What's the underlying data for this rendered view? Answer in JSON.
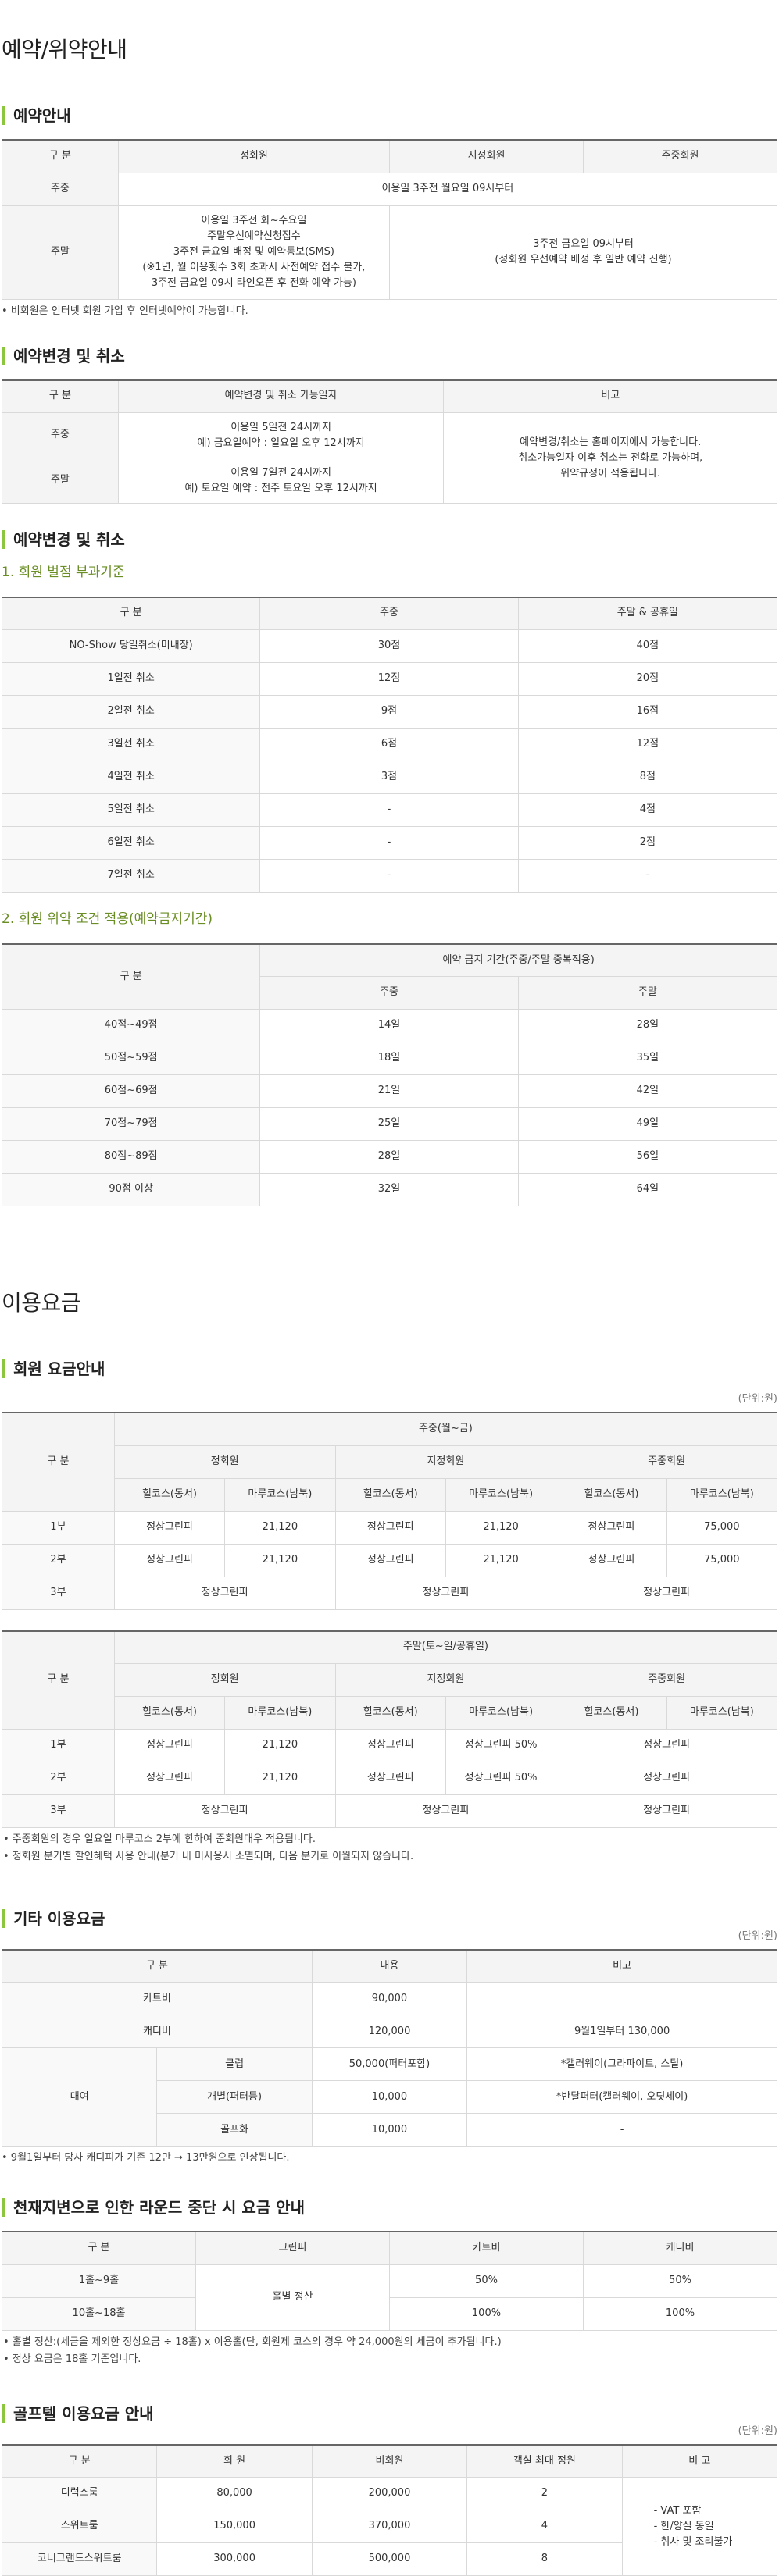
{
  "reservation": {
    "page_title": "예약/위약안내",
    "info": {
      "title": "예약안내",
      "headers": [
        "구 분",
        "정회원",
        "지정회원",
        "주중회원"
      ],
      "weekday": {
        "label": "주중",
        "text": "이용일 3주전 월요일 09시부터"
      },
      "weekend": {
        "label": "주말",
        "regular": [
          "이용일 3주전 화~수요일",
          "주말우선예약신청접수",
          "3주전 금요일 배정 및 예약통보(SMS)",
          "(※1년, 월 이용횟수 3회 초과시 사전예약 접수 불가,",
          "3주전 금요일 09시 타인오픈 후 전화 예약 가능)"
        ],
        "designated": [
          "3주전 금요일 09시부터",
          "(정회원 우선예약 배정 후 일반 예약 진행)"
        ]
      },
      "note": "• 비회원은 인터넷 회원 가입 후 인터넷예약이 가능합니다."
    },
    "change": {
      "title": "예약변경 및 취소",
      "headers": [
        "구 분",
        "예약변경 및 취소 가능일자",
        "비고"
      ],
      "weekday": {
        "label": "주중",
        "lines": [
          "이용일 5일전 24시까지",
          "예) 금요일예약 : 일요일 오후 12시까지"
        ]
      },
      "weekend": {
        "label": "주말",
        "lines": [
          "이용일 7일전 24시까지",
          "예) 토요일 예약 : 전주 토요일 오후 12시까지"
        ]
      },
      "remark": [
        "예약변경/취소는 홈페이지에서 가능합니다.",
        "취소가능일자 이후 취소는 전화로 가능하며,",
        "위약규정이 적용됩니다."
      ]
    },
    "penalty": {
      "title": "예약변경 및 취소",
      "sub1": "1. 회원 벌점 부과기준",
      "headers1": [
        "구 분",
        "주중",
        "주말 & 공휴일"
      ],
      "rows1": [
        [
          "NO-Show 당일취소(미내장)",
          "30점",
          "40점"
        ],
        [
          "1일전 취소",
          "12점",
          "20점"
        ],
        [
          "2일전 취소",
          "9점",
          "16점"
        ],
        [
          "3일전 취소",
          "6점",
          "12점"
        ],
        [
          "4일전 취소",
          "3점",
          "8점"
        ],
        [
          "5일전 취소",
          "-",
          "4점"
        ],
        [
          "6일전 취소",
          "-",
          "2점"
        ],
        [
          "7일전 취소",
          "-",
          "-"
        ]
      ],
      "sub2": "2. 회원 위약 조건 적용(예약금지기간)",
      "headers2": {
        "label": "구 분",
        "group": "예약 금지 기간(주중/주말 중복적용)",
        "weekday": "주중",
        "weekend": "주말"
      },
      "rows2": [
        [
          "40점~49점",
          "14일",
          "28일"
        ],
        [
          "50점~59점",
          "18일",
          "35일"
        ],
        [
          "60점~69점",
          "21일",
          "42일"
        ],
        [
          "70점~79점",
          "25일",
          "49일"
        ],
        [
          "80점~89점",
          "28일",
          "56일"
        ],
        [
          "90점 이상",
          "32일",
          "64일"
        ]
      ]
    }
  },
  "fees": {
    "page_title": "이용요금",
    "member": {
      "title": "회원 요금안내",
      "unit": "(단위:원)",
      "label": "구 분",
      "weekday_group": "주중(월~금)",
      "weekend_group": "주말(토~일/공휴일)",
      "members": [
        "정회원",
        "지정회원",
        "주중회원"
      ],
      "courses": [
        "힐코스(동서)",
        "마루코스(남북)"
      ],
      "weekday_rows": [
        {
          "label": "1부",
          "cells": [
            "정상그린피",
            "21,120",
            "정상그린피",
            "21,120",
            "정상그린피",
            "75,000"
          ]
        },
        {
          "label": "2부",
          "cells": [
            "정상그린피",
            "21,120",
            "정상그린피",
            "21,120",
            "정상그린피",
            "75,000"
          ]
        },
        {
          "label": "3부",
          "cells": [
            "정상그린피",
            "정상그린피",
            "정상그린피"
          ]
        }
      ],
      "weekend_rows": [
        {
          "label": "1부",
          "cells": [
            "정상그린피",
            "21,120",
            "정상그린피",
            "정상그린피 50%",
            "정상그린피"
          ]
        },
        {
          "label": "2부",
          "cells": [
            "정상그린피",
            "21,120",
            "정상그린피",
            "정상그린피 50%",
            "정상그린피"
          ]
        },
        {
          "label": "3부",
          "cells": [
            "정상그린피",
            "정상그린피",
            "정상그린피"
          ]
        }
      ],
      "notes": [
        "• 주중회원의 경우 일요일 마루코스 2부에 한하여 준회원대우 적용됩니다.",
        "• 정회원 분기별 할인혜택 사용 안내(분기 내 미사용시 소멸되며, 다음 분기로 이월되지 않습니다."
      ]
    },
    "other": {
      "title": "기타 이용요금",
      "unit": "(단위:원)",
      "headers": [
        "구 분",
        "내용",
        "비고"
      ],
      "cart": {
        "label": "카트비",
        "value": "90,000",
        "remark": ""
      },
      "caddie": {
        "label": "캐디비",
        "value": "120,000",
        "remark": "9월1일부터 130,000"
      },
      "rental_label": "대여",
      "rentals": [
        {
          "label": "클럽",
          "value": "50,000(퍼터포함)",
          "remark": "*캘러웨이(그라파이트, 스틸)"
        },
        {
          "label": "개별(퍼터등)",
          "value": "10,000",
          "remark": "*반달퍼터(캘러웨이, 오딧세이)"
        },
        {
          "label": "골프화",
          "value": "10,000",
          "remark": "-"
        }
      ],
      "note": "• 9월1일부터 당사 캐디피가 기존 12만 → 13만원으로 인상됩니다."
    },
    "weather": {
      "title": "천재지변으로 인한 라운드 중단 시 요금 안내",
      "headers": [
        "구 분",
        "그린피",
        "카트비",
        "캐디비"
      ],
      "green_fee": "홀별 정산",
      "rows": [
        {
          "label": "1홀~9홀",
          "cart": "50%",
          "caddie": "50%"
        },
        {
          "label": "10홀~18홀",
          "cart": "100%",
          "caddie": "100%"
        }
      ],
      "notes": [
        "• 홀별 정산:(세금을 제외한 정상요금 ÷ 18홀) x 이용홀(단, 회원제 코스의 경우 약 24,000원의 세금이 추가됩니다.)",
        "• 정상 요금은 18홀 기준입니다."
      ]
    },
    "hotel": {
      "title": "골프텔 이용요금 안내",
      "unit": "(단위:원)",
      "headers": [
        "구 분",
        "회 원",
        "비회원",
        "객실 최대 정원",
        "비 고"
      ],
      "rows": [
        [
          "디럭스룸",
          "80,000",
          "200,000",
          "2"
        ],
        [
          "스위트룸",
          "150,000",
          "370,000",
          "4"
        ],
        [
          "코너그랜드스위트룸",
          "300,000",
          "500,000",
          "8"
        ]
      ],
      "remarks": [
        "- VAT 포함",
        "- 한/양실 동일",
        "- 취사 및 조리불가"
      ]
    }
  }
}
